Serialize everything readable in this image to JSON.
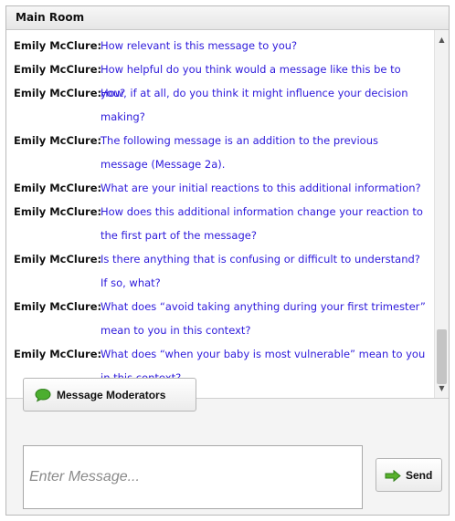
{
  "room": {
    "title": "Main Room"
  },
  "messages": [
    {
      "sender": "Emily McClure:",
      "text": "How relevant is this message to you?"
    },
    {
      "sender": "Emily McClure:",
      "text": "How helpful do you think would a message like this be to you?"
    },
    {
      "sender": "Emily McClure:",
      "text": "How, if at all, do you think it might influence your decision making?"
    },
    {
      "sender": "Emily McClure:",
      "text": "The following message is an addition to the previous message (Message 2a)."
    },
    {
      "sender": "Emily McClure:",
      "text": "What are your initial reactions to this additional information?"
    },
    {
      "sender": "Emily McClure:",
      "text": "How does this additional information change your reaction to the first part of the message?"
    },
    {
      "sender": "Emily McClure:",
      "text": "Is there anything that is confusing or difficult to understand? If so, what?"
    },
    {
      "sender": "Emily McClure:",
      "text": "What does “avoid taking anything during your first trimester” mean to you in this context?"
    },
    {
      "sender": "Emily McClure:",
      "text": "What does “when your baby is most vulnerable” mean to you in this context?"
    }
  ],
  "actions": {
    "moderators_label": "Message Moderators",
    "moderators_icon": "speech-bubble-icon",
    "send_label": "Send",
    "send_icon": "arrow-right-icon"
  },
  "input": {
    "placeholder": "Enter Message...",
    "value": ""
  },
  "colors": {
    "message_text": "#2d1adb",
    "sender_text": "#111111"
  }
}
